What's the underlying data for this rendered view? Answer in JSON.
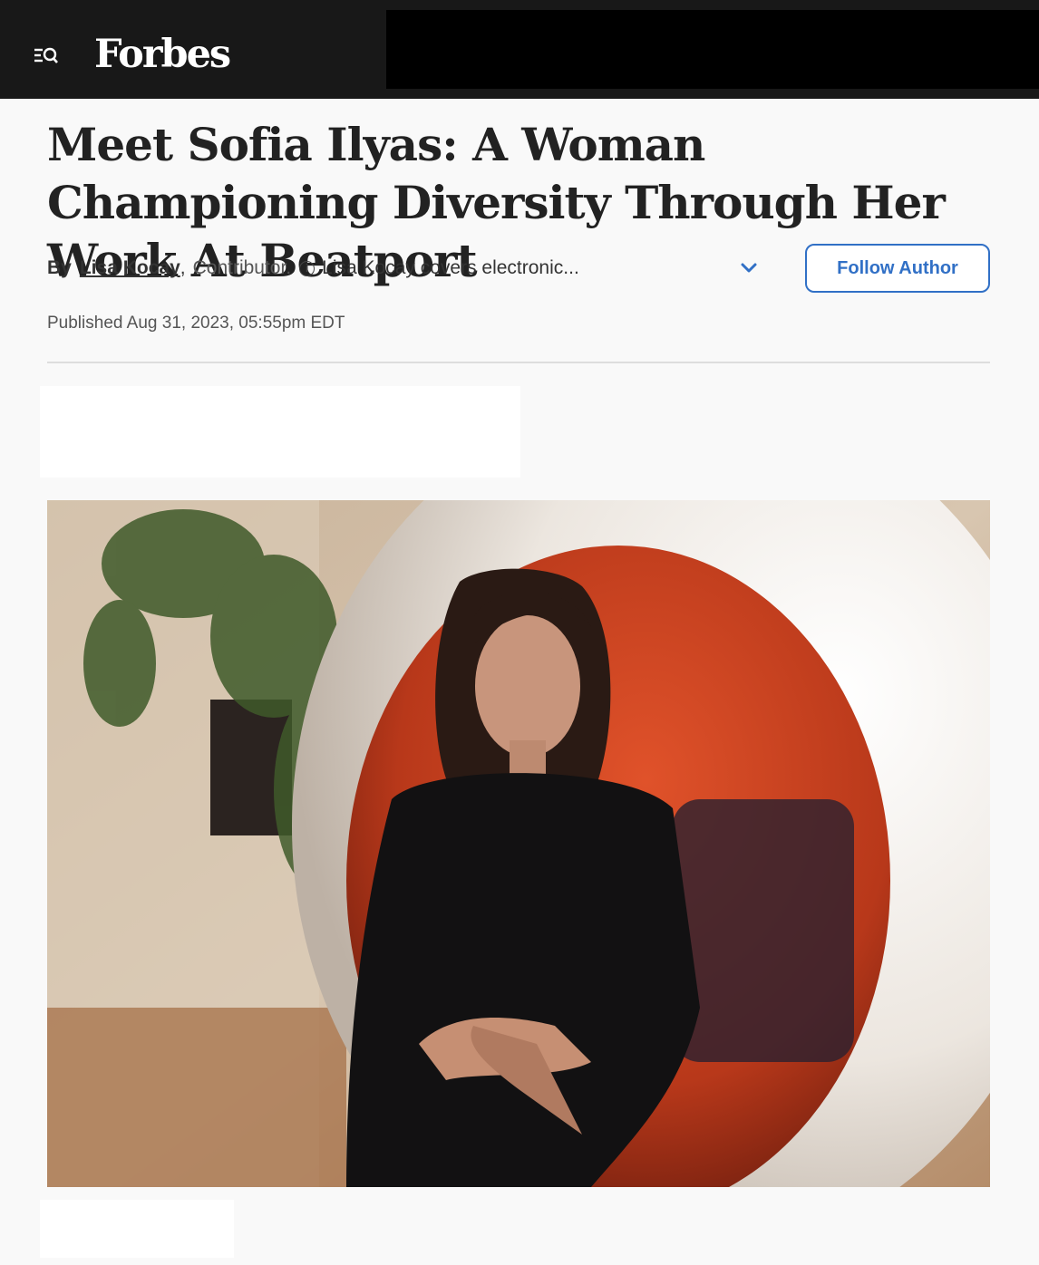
{
  "header": {
    "menu_icon": "menu-search-icon",
    "logo_text": "Forbes"
  },
  "article": {
    "headline": "Meet Sofia Ilyas: A Woman Championing Diversity Through Her Work At Beatport",
    "byline": {
      "prefix": "By",
      "author_name": "Lisa Kocay",
      "comma": ",",
      "role": "Contributor.",
      "info_icon": "info-icon",
      "bio_preview": "Lisa Kocay covers electronic...",
      "expand_icon": "chevron-down-icon"
    },
    "follow_button_label": "Follow Author",
    "published": "Published Aug 31, 2023, 05:55pm EDT"
  },
  "colors": {
    "header_bg": "#181818",
    "accent_blue": "#3170c6",
    "headline_text": "#222222",
    "page_bg": "#f9f9f9"
  }
}
